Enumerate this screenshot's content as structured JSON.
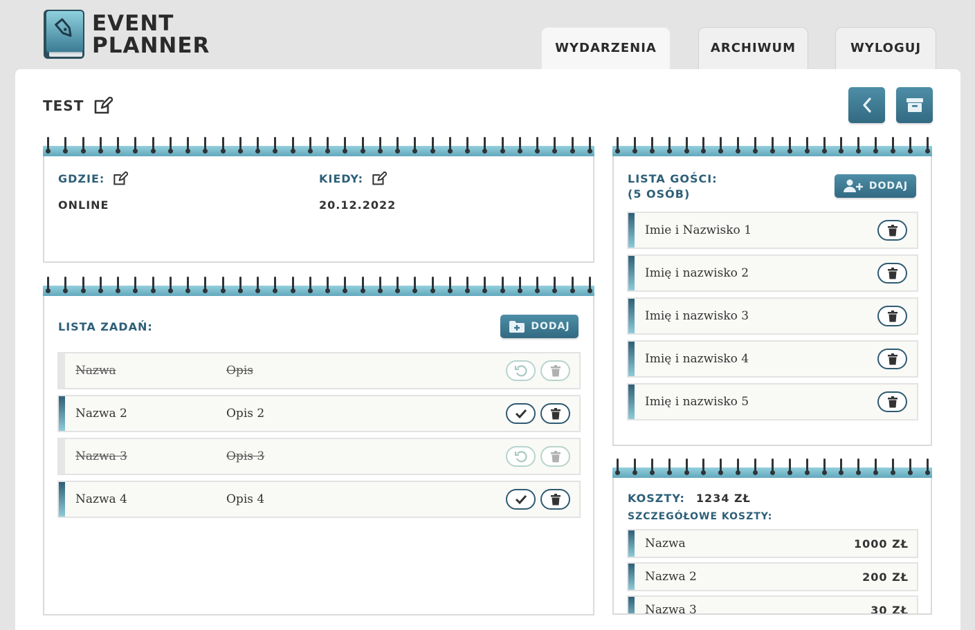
{
  "app": {
    "name_line1": "EVENT",
    "name_line2": "PLANNER"
  },
  "nav": {
    "tabs": [
      {
        "label": "WYDARZENIA"
      },
      {
        "label": "ARCHIWUM"
      },
      {
        "label": "WYLOGUJ"
      }
    ]
  },
  "event": {
    "title": "TEST"
  },
  "details": {
    "where_label": "GDZIE:",
    "where_value": "ONLINE",
    "when_label": "KIEDY:",
    "when_value": "20.12.2022"
  },
  "tasks": {
    "heading": "LISTA ZADAŃ:",
    "add_label": "DODAJ",
    "items": [
      {
        "name": "Nazwa",
        "desc": "Opis",
        "done": true
      },
      {
        "name": "Nazwa 2",
        "desc": "Opis 2",
        "done": false
      },
      {
        "name": "Nazwa 3",
        "desc": "Opis 3",
        "done": true
      },
      {
        "name": "Nazwa 4",
        "desc": "Opis 4",
        "done": false
      }
    ]
  },
  "guests": {
    "heading": "LISTA GOŚCI:",
    "count": "(5 OSÓB)",
    "add_label": "DODAJ",
    "items": [
      {
        "name": "Imie i Nazwisko 1"
      },
      {
        "name": "Imię i nazwisko 2"
      },
      {
        "name": "Imię i nazwisko 3"
      },
      {
        "name": "Imię i nazwisko 4"
      },
      {
        "name": "Imię i nazwisko 5"
      }
    ]
  },
  "costs": {
    "total_label": "KOSZTY:",
    "total_value": "1234 ZŁ",
    "details_label": "SZCZEGÓŁOWE KOSZTY:",
    "items": [
      {
        "name": "Nazwa",
        "amount": "1000 ZŁ"
      },
      {
        "name": "Nazwa 2",
        "amount": "200 ZŁ"
      },
      {
        "name": "Nazwa 3",
        "amount": "30 ZŁ"
      }
    ]
  },
  "colors": {
    "accent": "#326a82",
    "accent_light": "#62a8bd",
    "text": "#333333"
  }
}
